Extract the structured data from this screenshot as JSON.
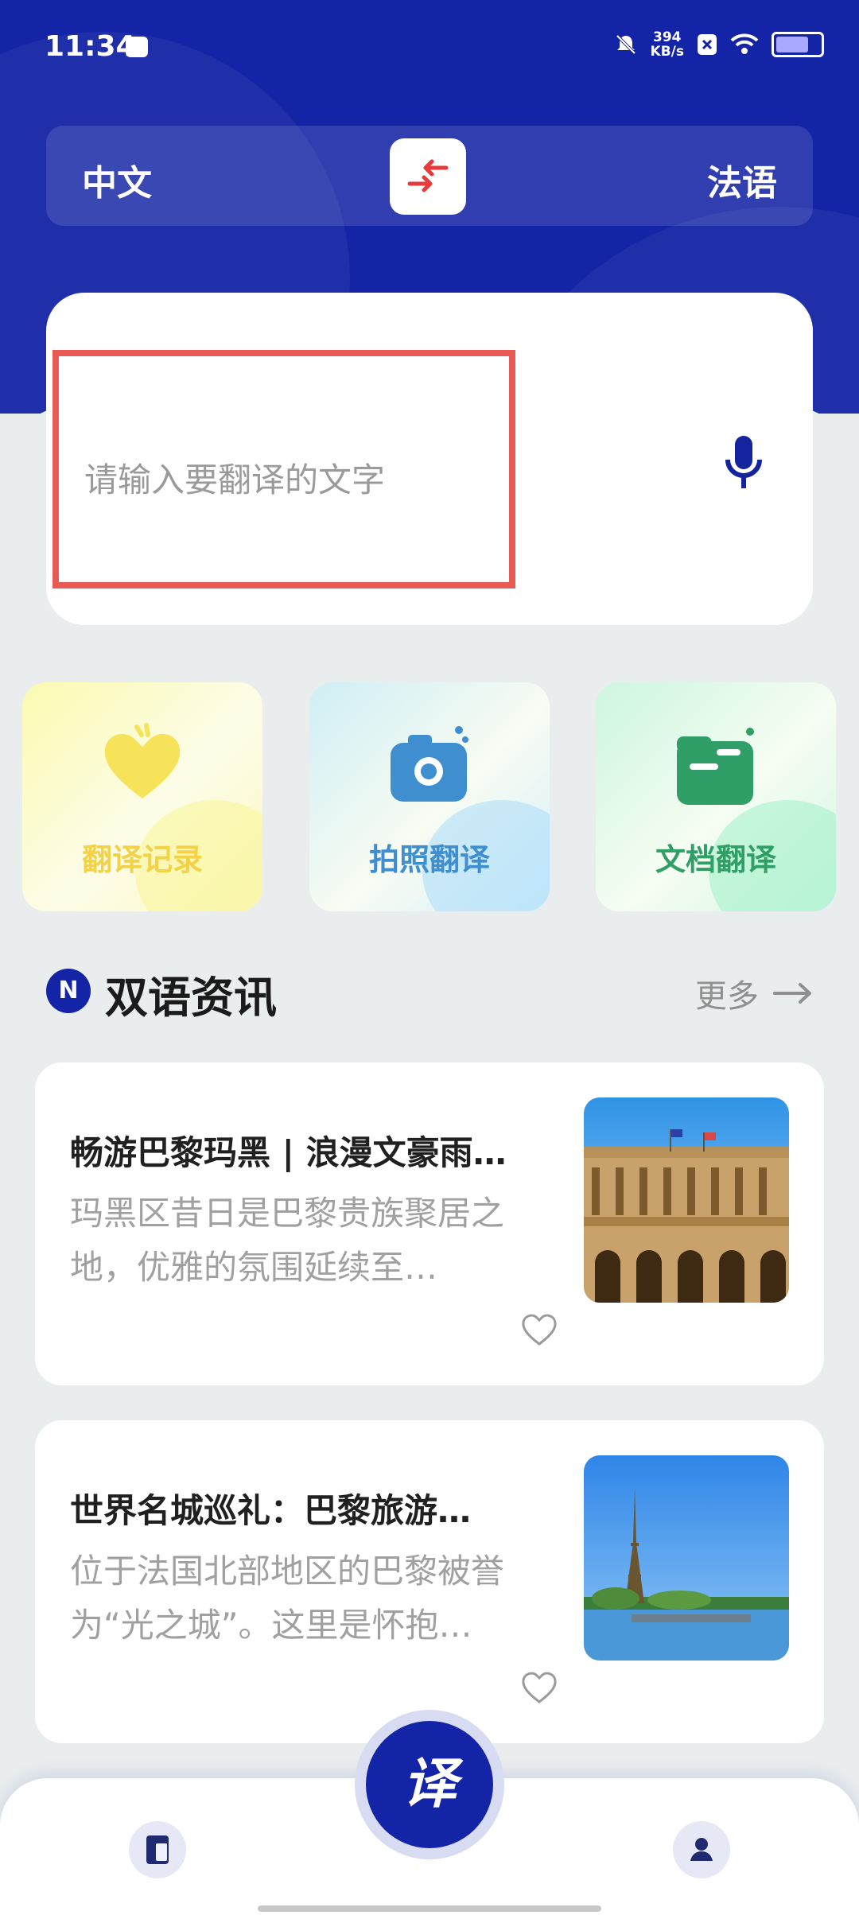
{
  "status_bar": {
    "time": "11:34",
    "net_speed_value": "394",
    "net_speed_unit": "KB/s",
    "icons": [
      "mail-icon",
      "mute-bell-icon",
      "sim-x-icon",
      "wifi-icon",
      "battery-icon"
    ]
  },
  "language_bar": {
    "source": "中文",
    "target": "法语",
    "swap_icon": "swap-arrows-icon"
  },
  "input": {
    "placeholder": "请输入要翻译的文字",
    "mic_icon": "microphone-icon"
  },
  "tools": [
    {
      "label": "翻译记录",
      "icon": "heart-icon"
    },
    {
      "label": "拍照翻译",
      "icon": "camera-icon"
    },
    {
      "label": "文档翻译",
      "icon": "folder-icon"
    }
  ],
  "news_section": {
    "badge": "N",
    "title": "双语资讯",
    "more": "更多"
  },
  "news": [
    {
      "title": "畅游巴黎玛黑 | 浪漫文豪雨…",
      "desc": "玛黑区昔日是巴黎贵族聚居之地，优雅的氛围延续至…"
    },
    {
      "title": "世界名城巡礼：巴黎旅游…",
      "desc": "位于法国北部地区的巴黎被誉为“光之城”。这里是怀抱…"
    }
  ],
  "bottom_nav": {
    "fab_label": "译",
    "left_icon": "book-icon",
    "right_icon": "profile-icon"
  },
  "colors": {
    "brand": "#1424a6",
    "highlight_border": "#e85a54",
    "tool_record": "#f3d24a",
    "tool_photo": "#3f8fd0",
    "tool_doc": "#2f9e67"
  }
}
